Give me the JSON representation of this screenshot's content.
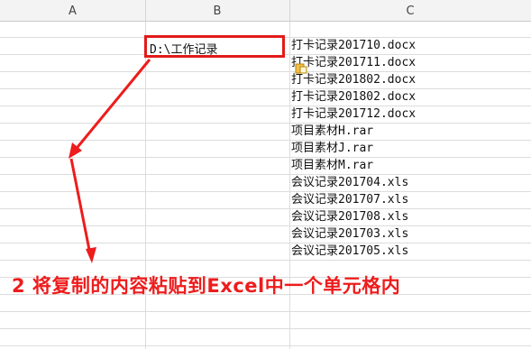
{
  "columns": [
    "A",
    "B",
    "C"
  ],
  "selected_cell": {
    "column": "B",
    "value": "D:\\工作记录"
  },
  "file_list": [
    "打卡记录201710.docx",
    "打卡记录201711.docx",
    "打卡记录201802.docx",
    "打卡记录201802.docx",
    "打卡记录201712.docx",
    "项目素材H.rar",
    "项目素材J.rar",
    "项目素材M.rar",
    "会议记录201704.xls",
    "会议记录201707.xls",
    "会议记录201708.xls",
    "会议记录201703.xls",
    "会议记录201705.xls"
  ],
  "instruction": "2  将复制的内容粘贴到Excel中一个单元格内",
  "colors": {
    "annotation": "#ee1c1c",
    "grid": "#dcdcdc",
    "header_bg": "#f3f3f3"
  },
  "icons": [
    "paste-options-icon"
  ]
}
